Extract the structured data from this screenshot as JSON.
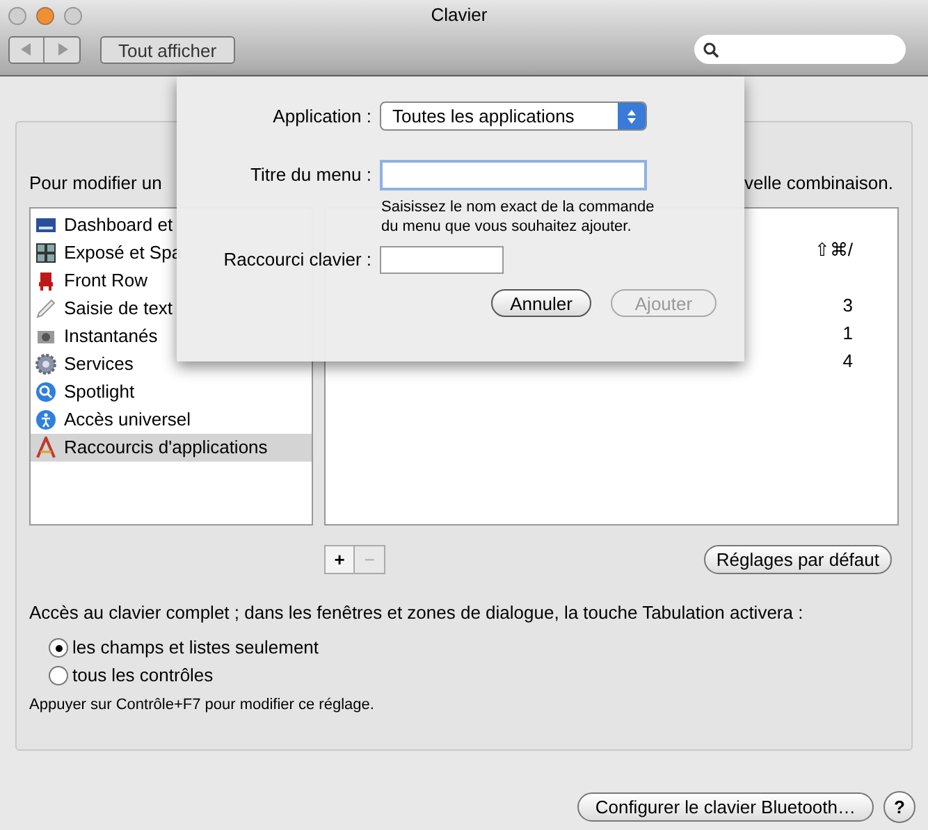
{
  "window": {
    "title": "Clavier",
    "show_all": "Tout afficher"
  },
  "intro_left": "Pour modifier un",
  "intro_right": "velle combinaison.",
  "sidebar": {
    "items": [
      {
        "label": "Dashboard et",
        "selected": false
      },
      {
        "label": "Exposé et Spa",
        "selected": false
      },
      {
        "label": "Front Row",
        "selected": false
      },
      {
        "label": "Saisie de text",
        "selected": false
      },
      {
        "label": "Instantanés",
        "selected": false
      },
      {
        "label": "Services",
        "selected": false
      },
      {
        "label": "Spotlight",
        "selected": false
      },
      {
        "label": "Accès universel",
        "selected": false
      },
      {
        "label": "Raccourcis d'applications",
        "selected": true
      }
    ]
  },
  "shortcuts": [
    "⇧⌘/",
    "3",
    "1",
    "4"
  ],
  "add": "+",
  "remove": "−",
  "defaults_button": "Réglages par défaut",
  "full_access": {
    "label": "Accès au clavier complet ; dans les fenêtres et zones de dialogue, la touche Tabulation activera :",
    "options": [
      {
        "label": "les champs et listes seulement",
        "selected": true
      },
      {
        "label": "tous les contrôles",
        "selected": false
      }
    ],
    "note": "Appuyer sur Contrôle+F7 pour modifier ce réglage."
  },
  "bluetooth_button": "Configurer le clavier Bluetooth…",
  "help": "?",
  "sheet": {
    "application_label": "Application :",
    "application_value": "Toutes les applications",
    "menu_title_label": "Titre du menu :",
    "hint": "Saisissez le nom exact de la commande\ndu menu que vous souhaitez ajouter.",
    "shortcut_label": "Raccourci clavier :",
    "cancel": "Annuler",
    "add": {
      "label": "Ajouter",
      "disabled": true
    }
  }
}
